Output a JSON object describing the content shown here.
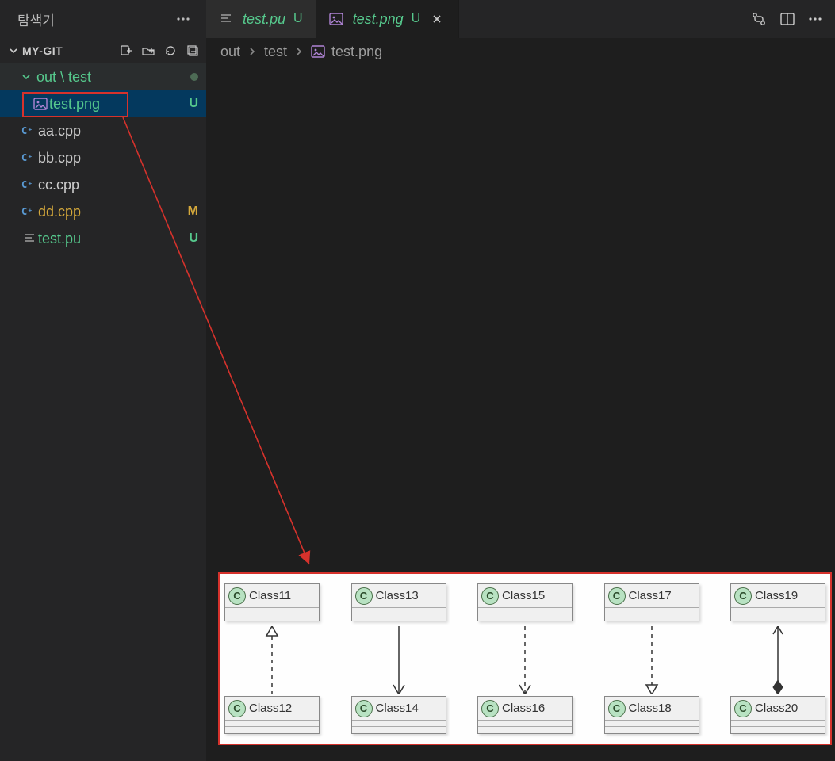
{
  "sidebar": {
    "title": "탐색기",
    "section": "MY-GIT",
    "folder": {
      "path": "out \\ test"
    },
    "items": [
      {
        "name": "test.png",
        "badge": "U",
        "color": "green",
        "icon": "image",
        "active": true
      },
      {
        "name": "aa.cpp",
        "badge": "",
        "color": "file",
        "icon": "cpp"
      },
      {
        "name": "bb.cpp",
        "badge": "",
        "color": "file",
        "icon": "cpp"
      },
      {
        "name": "cc.cpp",
        "badge": "",
        "color": "file",
        "icon": "cpp"
      },
      {
        "name": "dd.cpp",
        "badge": "M",
        "color": "yellow",
        "icon": "cpp"
      },
      {
        "name": "test.pu",
        "badge": "U",
        "color": "green",
        "icon": "lines"
      }
    ]
  },
  "tabs": [
    {
      "label": "test.pu",
      "status": "U",
      "icon": "lines",
      "active": false,
      "close": false
    },
    {
      "label": "test.png",
      "status": "U",
      "icon": "image",
      "active": true,
      "close": true
    }
  ],
  "breadcrumbs": {
    "parts": [
      "out",
      "test",
      "test.png"
    ]
  },
  "uml": {
    "pairs": [
      {
        "top": "Class11",
        "bot": "Class12",
        "rel": "realization_up"
      },
      {
        "top": "Class13",
        "bot": "Class14",
        "rel": "assoc_down"
      },
      {
        "top": "Class15",
        "bot": "Class16",
        "rel": "depend_down"
      },
      {
        "top": "Class17",
        "bot": "Class18",
        "rel": "realization_down"
      },
      {
        "top": "Class19",
        "bot": "Class20",
        "rel": "composition"
      }
    ]
  }
}
